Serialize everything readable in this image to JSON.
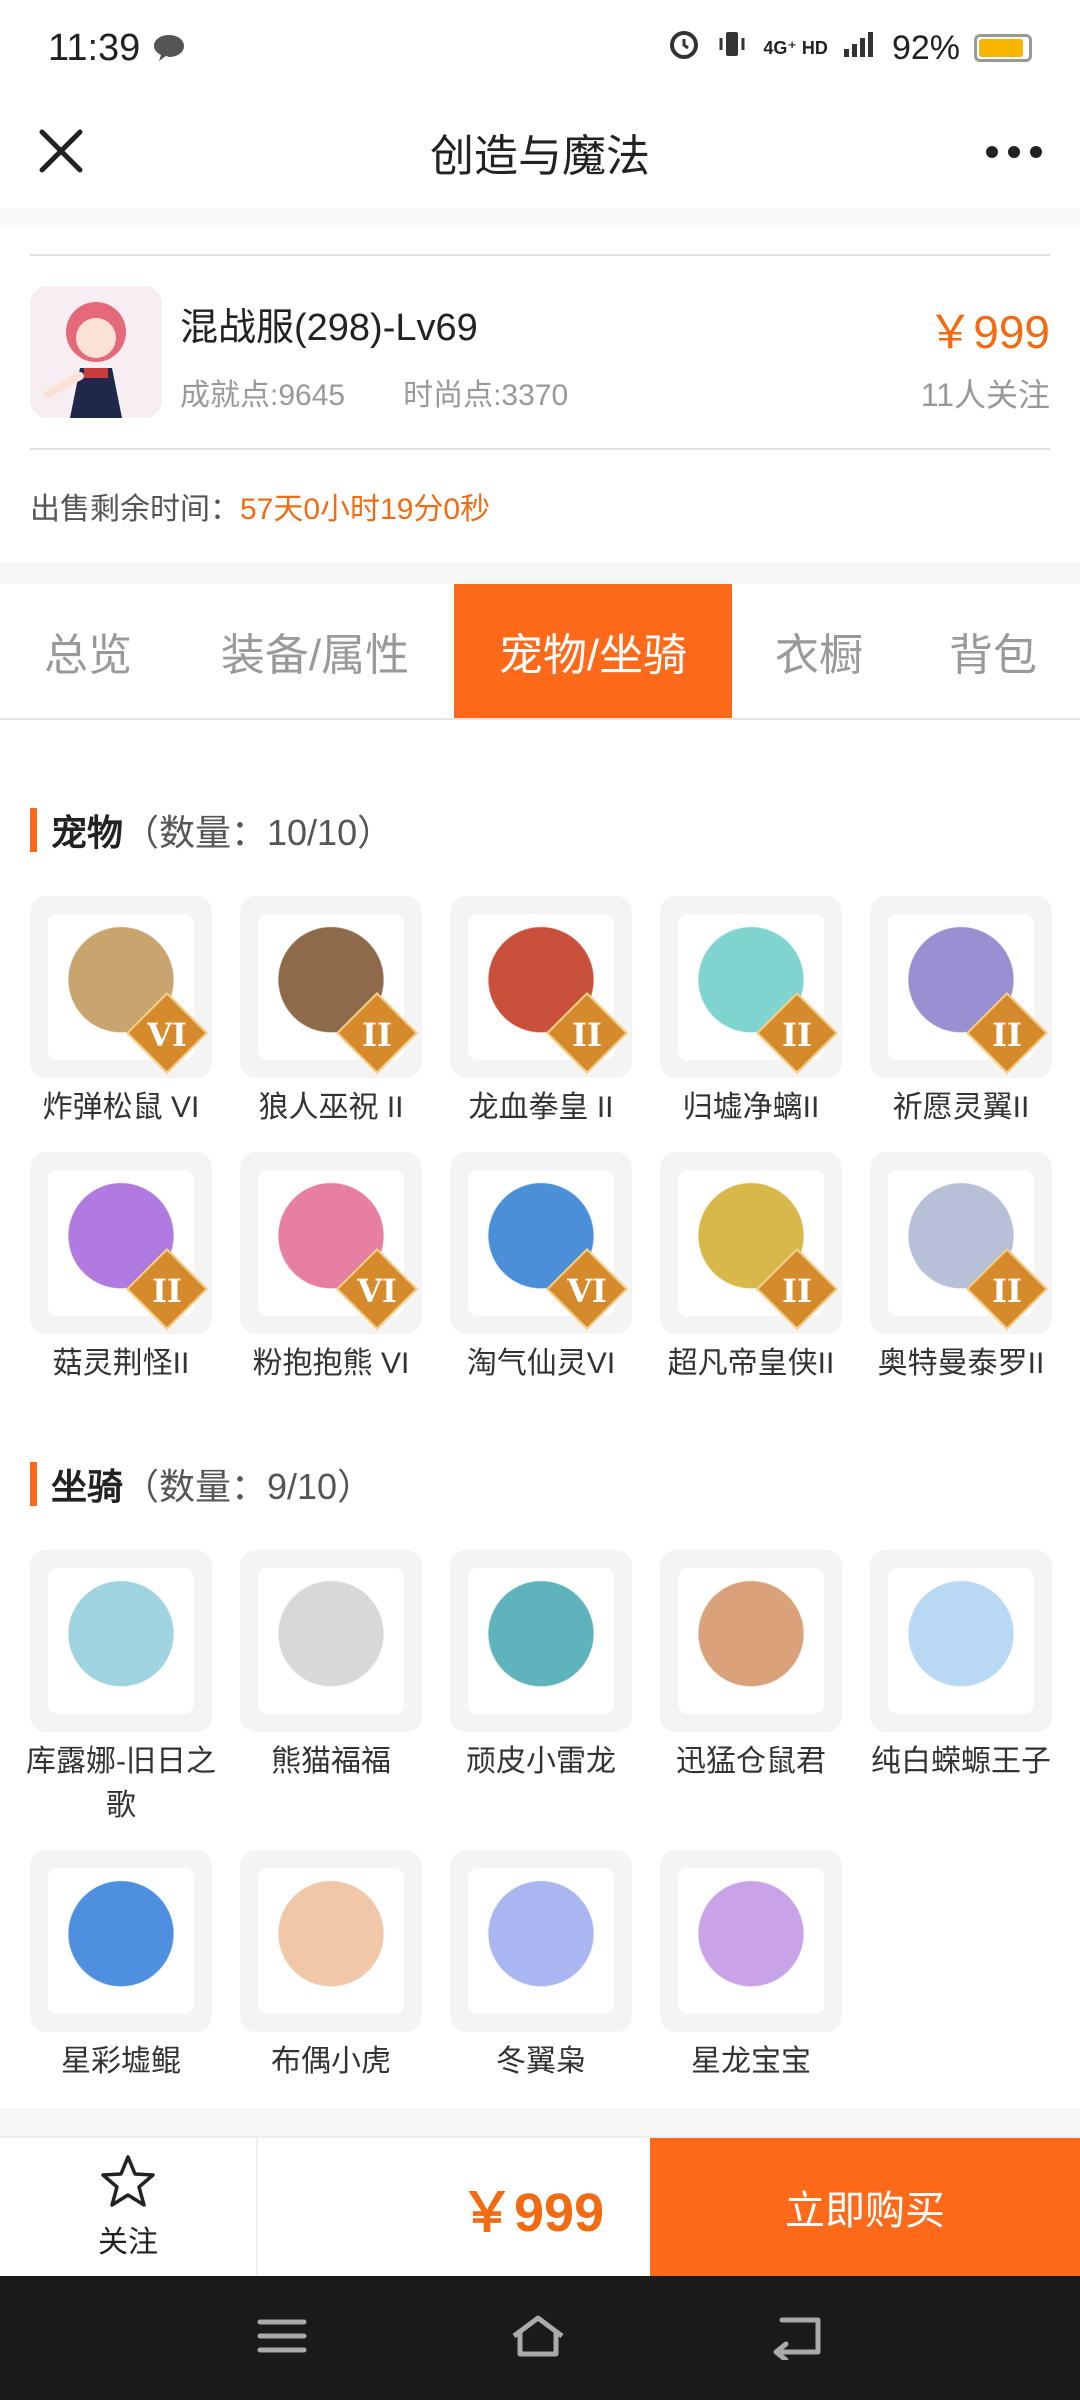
{
  "status_bar": {
    "time": "11:39",
    "network": "4G⁺ HD",
    "battery_text": "92%",
    "battery_level": 0.92
  },
  "header": {
    "title": "创造与魔法"
  },
  "summary": {
    "character": "混战服(298)-Lv69",
    "achievement": "成就点:9645",
    "fashion": "时尚点:3370",
    "price": "￥999",
    "followers": "11人关注",
    "remaining_label": "出售剩余时间：",
    "remaining_value": "57天0小时19分0秒"
  },
  "tabs": [
    {
      "label": "总览"
    },
    {
      "label": "装备/属性"
    },
    {
      "label": "宠物/坐骑"
    },
    {
      "label": "衣橱"
    },
    {
      "label": "背包"
    }
  ],
  "pets": {
    "title": "宠物",
    "count": "（数量：10/10）",
    "items": [
      {
        "name": "炸弹松鼠 VI",
        "rank": "VI",
        "color": "#c8a46e"
      },
      {
        "name": "狼人巫祝 II",
        "rank": "II",
        "color": "#8d6a4a"
      },
      {
        "name": "龙血拳皇 II",
        "rank": "II",
        "color": "#c9503b"
      },
      {
        "name": "归墟净螭II",
        "rank": "II",
        "color": "#7fd4d0"
      },
      {
        "name": "祈愿灵翼II",
        "rank": "II",
        "color": "#9a8fd0"
      },
      {
        "name": "菇灵荆怪II",
        "rank": "II",
        "color": "#b07ae0"
      },
      {
        "name": "粉抱抱熊 VI",
        "rank": "VI",
        "color": "#e77fa3"
      },
      {
        "name": "淘气仙灵VI",
        "rank": "VI",
        "color": "#4a8fd8"
      },
      {
        "name": "超凡帝皇侠II",
        "rank": "II",
        "color": "#d8b84a"
      },
      {
        "name": "奥特曼泰罗II",
        "rank": "II",
        "color": "#b8c0d8"
      }
    ]
  },
  "mounts": {
    "title": "坐骑",
    "count": "（数量：9/10）",
    "items": [
      {
        "name": "库露娜-旧日之歌",
        "color": "#9fd3e0"
      },
      {
        "name": "熊猫福福",
        "color": "#d8d8d8"
      },
      {
        "name": "顽皮小雷龙",
        "color": "#5fb3bd"
      },
      {
        "name": "迅猛仓鼠君",
        "color": "#d9a27a"
      },
      {
        "name": "纯白蝾螈王子",
        "color": "#b9d8f3"
      },
      {
        "name": "星彩墟鲲",
        "color": "#4f8fe0"
      },
      {
        "name": "布偶小虎",
        "color": "#f0c7a8"
      },
      {
        "name": "冬翼枭",
        "color": "#a9b6f0"
      },
      {
        "name": "星龙宝宝",
        "color": "#c8a3e8"
      }
    ]
  },
  "bottom": {
    "follow_label": "关注",
    "price": "￥999",
    "buy_label": "立即购买"
  }
}
